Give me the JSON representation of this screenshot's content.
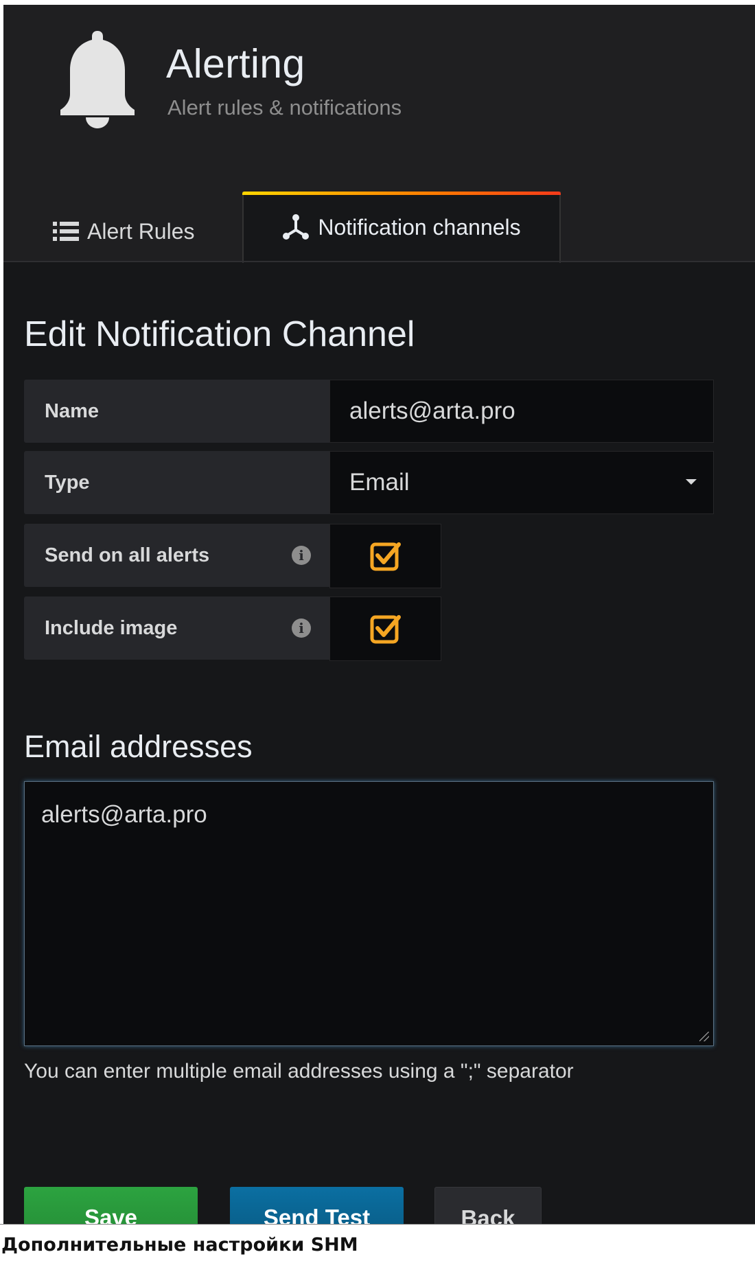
{
  "header": {
    "title": "Alerting",
    "subtitle": "Alert rules & notifications",
    "icon": "bell-icon"
  },
  "tabs": [
    {
      "label": "Alert Rules",
      "icon": "list-icon",
      "active": false
    },
    {
      "label": "Notification channels",
      "icon": "channels-icon",
      "active": true
    }
  ],
  "page_title": "Edit Notification Channel",
  "form": {
    "name_label": "Name",
    "name_value": "alerts@arta.pro",
    "type_label": "Type",
    "type_value": "Email",
    "send_all_label": "Send on all alerts",
    "send_all_checked": true,
    "include_image_label": "Include image",
    "include_image_checked": true
  },
  "email": {
    "section_title": "Email addresses",
    "value": "alerts@arta.pro",
    "hint": "You can enter multiple email addresses using a \";\" separator"
  },
  "buttons": {
    "save": "Save",
    "send_test": "Send Test",
    "back": "Back"
  },
  "footer_caption": "Дополнительные настройки SHM",
  "colors": {
    "accent_orange": "#f5a623",
    "save_green": "#2ca340",
    "test_blue": "#0b6fa2",
    "panel_bg": "#161719"
  }
}
